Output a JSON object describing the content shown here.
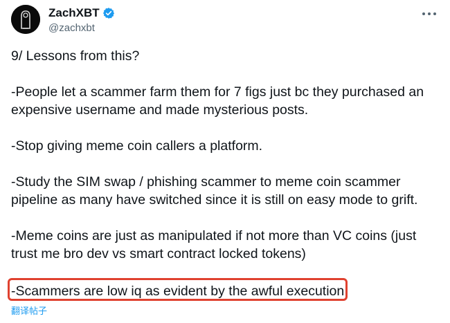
{
  "author": {
    "display_name": "ZachXBT",
    "handle": "@zachxbt",
    "verified_color": "#1d9bf0"
  },
  "menu": {
    "icon": "more-dots-icon"
  },
  "tweet": {
    "paragraphs": [
      "9/ Lessons from this?",
      "-People let a scammer farm them for 7 figs just bc they purchased an expensive username and made mysterious posts.",
      "-Stop giving meme coin callers a platform.",
      "-Study the SIM swap / phishing scammer to meme coin scammer pipeline as many have switched since it is still on easy mode to grift.",
      "-Meme coins are just as manipulated if not more than VC coins (just trust me bro dev vs smart contract locked tokens)"
    ],
    "highlighted_line": "-Scammers are low iq as evident by the awful execution",
    "highlight_color": "#e0412f"
  },
  "translate_label": "翻译帖子"
}
